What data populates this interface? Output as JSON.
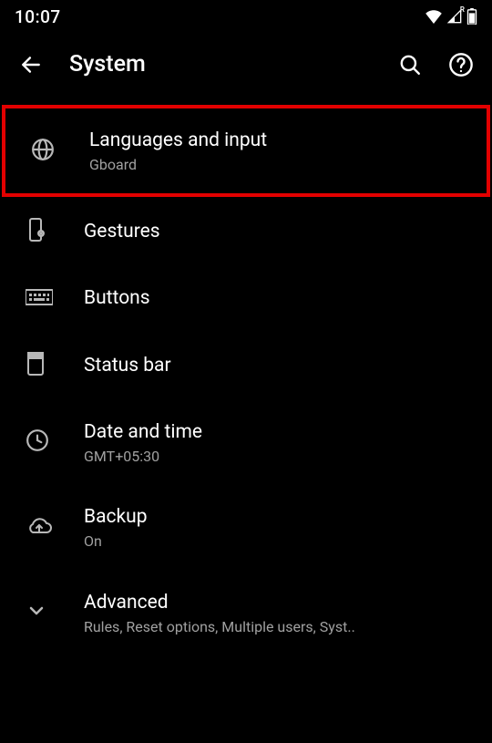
{
  "status": {
    "time": "10:07"
  },
  "header": {
    "title": "System"
  },
  "items": [
    {
      "title": "Languages and input",
      "subtitle": "Gboard"
    },
    {
      "title": "Gestures",
      "subtitle": ""
    },
    {
      "title": "Buttons",
      "subtitle": ""
    },
    {
      "title": "Status bar",
      "subtitle": ""
    },
    {
      "title": "Date and time",
      "subtitle": "GMT+05:30"
    },
    {
      "title": "Backup",
      "subtitle": "On"
    },
    {
      "title": "Advanced",
      "subtitle": "Rules, Reset options, Multiple users, Syst.."
    }
  ]
}
